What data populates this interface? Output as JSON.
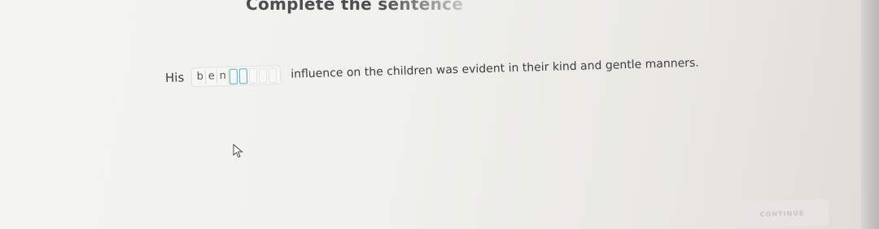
{
  "title": "Complete the sentence",
  "sentence": {
    "before": "His",
    "letters": [
      "b",
      "e",
      "n"
    ],
    "after": "influence on the children was evident in their kind and gentle manners."
  },
  "continue_label": "CONTINUE",
  "colors": {
    "active_blank": "#56aecb",
    "text": "#3d3d42"
  },
  "icons": {
    "cursor": "mouse-pointer-icon"
  }
}
